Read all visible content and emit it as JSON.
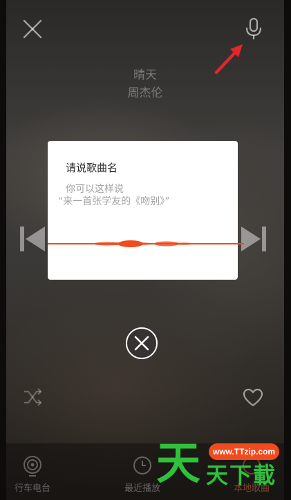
{
  "player": {
    "song_title": "晴天",
    "artist": "周杰伦"
  },
  "voice_dialog": {
    "title": "请说歌曲名",
    "hint_line1": "你可以这样说",
    "hint_line2": "“来一首张学友的《吻别》”"
  },
  "bottom_tabs": [
    {
      "label": "行车电台",
      "icon": "radio-icon"
    },
    {
      "label": "最近播放",
      "icon": "clock-note-icon"
    },
    {
      "label": "本地歌曲",
      "icon": "local-music-icon"
    }
  ],
  "watermark": {
    "url": "www.TTzip.com",
    "big_char": "天",
    "small_chars": "天下載"
  },
  "colors": {
    "accent_orange": "#f04a1e",
    "arrow_red": "#e3262b",
    "watermark_green": "#2fc13b"
  }
}
